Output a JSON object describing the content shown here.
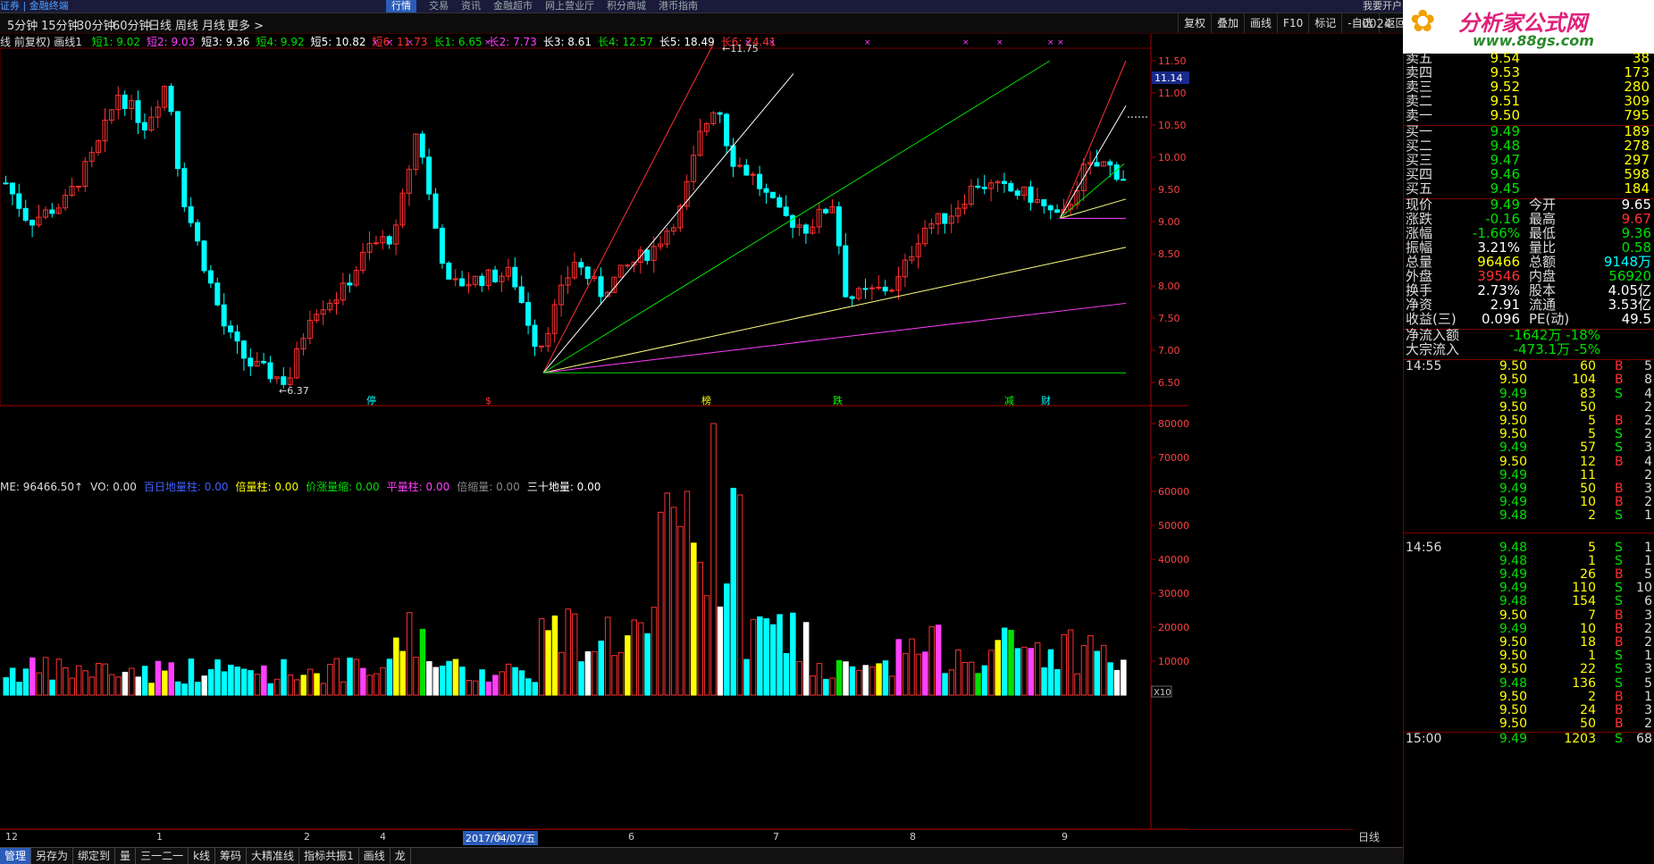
{
  "topbar": {
    "logo": "证券 | 金融终端",
    "menu": [
      "行情",
      "交易",
      "资讯",
      "金融超市",
      "网上营业厅",
      "积分商城",
      "港币指南"
    ],
    "active": 0,
    "right": "我要开户 | 发现者"
  },
  "brand": {
    "name": "分析家公式网",
    "url": "www.88gs.com",
    "code": "0024"
  },
  "periods": [
    "5分钟",
    "15分钟",
    "30分钟",
    "60分钟",
    "日线",
    "周线",
    "月线",
    "更多 >"
  ],
  "tools": [
    "复权",
    "叠加",
    "画线",
    "F10",
    "标记",
    "-自选",
    "返回"
  ],
  "indicator_title": "线 前复权) 画线1",
  "indicators": [
    {
      "label": "短1: 9.02",
      "color": "#00e000"
    },
    {
      "label": "短2: 9.03",
      "color": "#ff40ff"
    },
    {
      "label": "短3: 9.36",
      "color": "#fff"
    },
    {
      "label": "短4: 9.92",
      "color": "#00e000"
    },
    {
      "label": "短5: 10.82",
      "color": "#fff"
    },
    {
      "label": "短6: 11.73",
      "color": "#ff3030"
    },
    {
      "label": "长1: 6.65",
      "color": "#00e000"
    },
    {
      "label": "长2: 7.73",
      "color": "#ff40ff"
    },
    {
      "label": "长3: 8.61",
      "color": "#fff"
    },
    {
      "label": "长4: 12.57",
      "color": "#00e000"
    },
    {
      "label": "长5: 18.49",
      "color": "#fff"
    },
    {
      "label": "长6: 24.41",
      "color": "#ff3030"
    }
  ],
  "price_axis": {
    "labels": [
      "11.50",
      "11.00",
      "10.50",
      "10.00",
      "9.50",
      "9.00",
      "8.50",
      "8.00",
      "7.50",
      "7.00",
      "6.50"
    ],
    "current": "11.14",
    "high_mark": "11.75",
    "low_mark": "6.37"
  },
  "event_labels": [
    "停",
    "$",
    "榜",
    "跌",
    "减",
    "财"
  ],
  "vol_axis": {
    "labels": [
      "80000",
      "70000",
      "60000",
      "50000",
      "40000",
      "30000",
      "20000",
      "10000"
    ],
    "unit": "X10"
  },
  "volume_info": [
    {
      "label": "ME: 96466.50↑",
      "color": "#ddd"
    },
    {
      "label": "VO: 0.00",
      "color": "#ddd"
    },
    {
      "label": "百日地量柱: 0.00",
      "color": "#4060ff"
    },
    {
      "label": "倍量柱: 0.00",
      "color": "#ffff00"
    },
    {
      "label": "价涨量缩: 0.00",
      "color": "#00e000"
    },
    {
      "label": "平量柱: 0.00",
      "color": "#ff40ff"
    },
    {
      "label": "倍缩量: 0.00",
      "color": "#888"
    },
    {
      "label": "三十地量: 0.00",
      "color": "#fff"
    }
  ],
  "time_axis": {
    "ticks": [
      "12",
      "1",
      "2",
      "4",
      "5",
      "6",
      "7",
      "8",
      "9"
    ],
    "date": "2017/04/07/五",
    "period": "日线"
  },
  "bottom_tabs": [
    "管理",
    "另存为",
    "绑定到",
    "量",
    "三一二一",
    "k线",
    "筹码",
    "大精准线",
    "指标共振1",
    "画线",
    "龙"
  ],
  "quote": {
    "asks": [
      {
        "l": "卖五",
        "p": "9.54",
        "q": "38"
      },
      {
        "l": "卖四",
        "p": "9.53",
        "q": "173"
      },
      {
        "l": "卖三",
        "p": "9.52",
        "q": "280"
      },
      {
        "l": "卖二",
        "p": "9.51",
        "q": "309"
      },
      {
        "l": "卖一",
        "p": "9.50",
        "q": "795"
      }
    ],
    "bids": [
      {
        "l": "买一",
        "p": "9.49",
        "q": "189"
      },
      {
        "l": "买二",
        "p": "9.48",
        "q": "278"
      },
      {
        "l": "买三",
        "p": "9.47",
        "q": "297"
      },
      {
        "l": "买四",
        "p": "9.46",
        "q": "598"
      },
      {
        "l": "买五",
        "p": "9.45",
        "q": "184"
      }
    ],
    "stats": [
      {
        "l": "现价",
        "v": "9.49",
        "c": "grn",
        "l2": "今开",
        "v2": "9.65",
        "c2": "wht"
      },
      {
        "l": "涨跌",
        "v": "-0.16",
        "c": "grn",
        "l2": "最高",
        "v2": "9.67",
        "c2": "red"
      },
      {
        "l": "涨幅",
        "v": "-1.66%",
        "c": "grn",
        "l2": "最低",
        "v2": "9.36",
        "c2": "grn"
      },
      {
        "l": "振幅",
        "v": "3.21%",
        "c": "wht",
        "l2": "量比",
        "v2": "0.58",
        "c2": "grn"
      },
      {
        "l": "总量",
        "v": "96466",
        "c": "yel",
        "l2": "总额",
        "v2": "9148万",
        "c2": "cyn"
      },
      {
        "l": "外盘",
        "v": "39546",
        "c": "red",
        "l2": "内盘",
        "v2": "56920",
        "c2": "grn"
      },
      {
        "l": "换手",
        "v": "2.73%",
        "c": "wht",
        "l2": "股本",
        "v2": "4.05亿",
        "c2": "wht"
      },
      {
        "l": "净资",
        "v": "2.91",
        "c": "wht",
        "l2": "流通",
        "v2": "3.53亿",
        "c2": "wht"
      },
      {
        "l": "收益(三)",
        "v": "0.096",
        "c": "wht",
        "l2": "PE(动)",
        "v2": "49.5",
        "c2": "wht"
      }
    ],
    "flow": [
      {
        "l": "净流入额",
        "v": "-1642万",
        "v2": "-18%"
      },
      {
        "l": "大宗流入",
        "v": "-473.1万",
        "v2": "-5%"
      }
    ],
    "ticks": [
      {
        "t": "14:55",
        "p": "9.50",
        "v": "60",
        "b": "B",
        "n": "5",
        "c": "yel"
      },
      {
        "t": "",
        "p": "9.50",
        "v": "104",
        "b": "B",
        "n": "8",
        "c": "yel"
      },
      {
        "t": "",
        "p": "9.49",
        "v": "83",
        "b": "S",
        "n": "4",
        "c": "grn"
      },
      {
        "t": "",
        "p": "9.50",
        "v": "50",
        "b": "",
        "n": "2",
        "c": "yel"
      },
      {
        "t": "",
        "p": "9.50",
        "v": "5",
        "b": "B",
        "n": "2",
        "c": "yel"
      },
      {
        "t": "",
        "p": "9.50",
        "v": "5",
        "b": "S",
        "n": "2",
        "c": "yel"
      },
      {
        "t": "",
        "p": "9.49",
        "v": "57",
        "b": "S",
        "n": "3",
        "c": "grn"
      },
      {
        "t": "",
        "p": "9.50",
        "v": "12",
        "b": "B",
        "n": "4",
        "c": "yel"
      },
      {
        "t": "",
        "p": "9.49",
        "v": "11",
        "b": "",
        "n": "2",
        "c": "grn"
      },
      {
        "t": "",
        "p": "9.49",
        "v": "50",
        "b": "B",
        "n": "3",
        "c": "grn"
      },
      {
        "t": "",
        "p": "9.49",
        "v": "10",
        "b": "B",
        "n": "2",
        "c": "grn"
      },
      {
        "t": "",
        "p": "9.48",
        "v": "2",
        "b": "S",
        "n": "1",
        "c": "grn"
      },
      {
        "t": "14:56",
        "p": "9.48",
        "v": "5",
        "b": "S",
        "n": "1",
        "c": "grn"
      },
      {
        "t": "",
        "p": "9.48",
        "v": "1",
        "b": "S",
        "n": "1",
        "c": "grn"
      },
      {
        "t": "",
        "p": "9.49",
        "v": "26",
        "b": "B",
        "n": "5",
        "c": "grn"
      },
      {
        "t": "",
        "p": "9.49",
        "v": "110",
        "b": "S",
        "n": "10",
        "c": "grn"
      },
      {
        "t": "",
        "p": "9.48",
        "v": "154",
        "b": "S",
        "n": "6",
        "c": "grn"
      },
      {
        "t": "",
        "p": "9.50",
        "v": "7",
        "b": "B",
        "n": "3",
        "c": "yel"
      },
      {
        "t": "",
        "p": "9.49",
        "v": "10",
        "b": "B",
        "n": "2",
        "c": "grn"
      },
      {
        "t": "",
        "p": "9.50",
        "v": "18",
        "b": "B",
        "n": "2",
        "c": "yel"
      },
      {
        "t": "",
        "p": "9.50",
        "v": "1",
        "b": "S",
        "n": "1",
        "c": "yel"
      },
      {
        "t": "",
        "p": "9.50",
        "v": "22",
        "b": "S",
        "n": "3",
        "c": "yel"
      },
      {
        "t": "",
        "p": "9.48",
        "v": "136",
        "b": "S",
        "n": "5",
        "c": "grn"
      },
      {
        "t": "",
        "p": "9.50",
        "v": "2",
        "b": "B",
        "n": "1",
        "c": "yel"
      },
      {
        "t": "",
        "p": "9.50",
        "v": "24",
        "b": "B",
        "n": "3",
        "c": "yel"
      },
      {
        "t": "",
        "p": "9.50",
        "v": "50",
        "b": "B",
        "n": "2",
        "c": "yel"
      },
      {
        "t": "15:00",
        "p": "9.49",
        "v": "1203",
        "b": "S",
        "n": "68",
        "c": "grn"
      }
    ]
  }
}
